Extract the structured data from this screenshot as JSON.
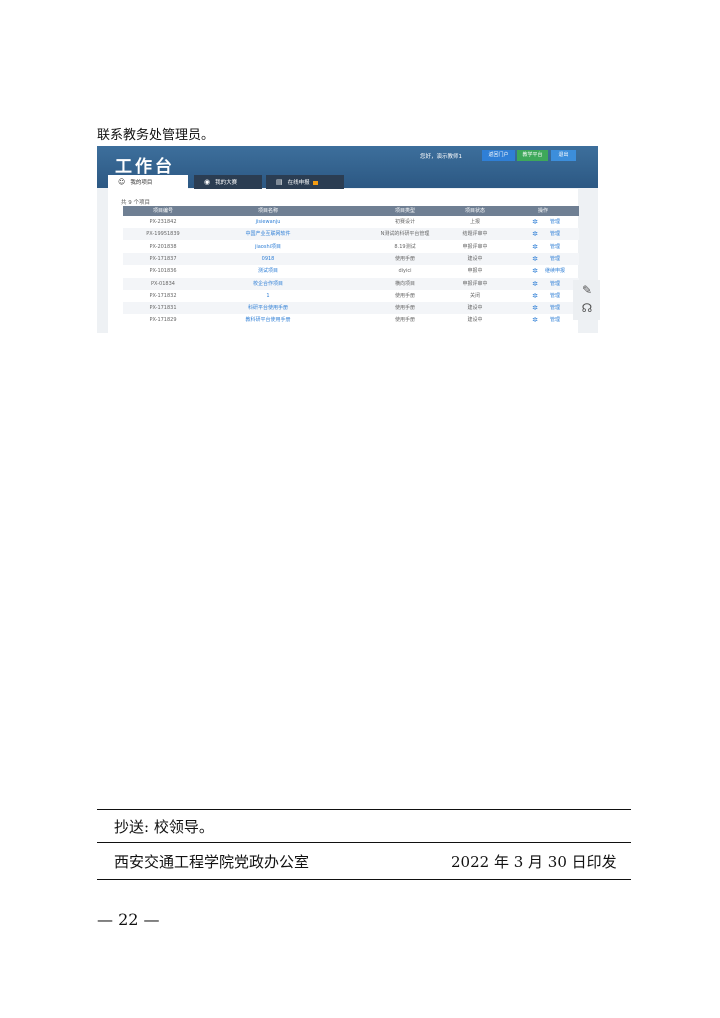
{
  "intro": "联系教务处管理员。",
  "screenshot": {
    "title": "工作台",
    "greeting": "您好，演示教师1",
    "buttons": {
      "portal": "返回门户",
      "teach": "教学平台",
      "exit": "退出"
    },
    "tabs": [
      "我的项目",
      "我的大赛",
      "在线申报"
    ],
    "count": "共 9 个项目",
    "columns": [
      "项目编号",
      "项目名称",
      "项目类型",
      "项目状态",
      "操作"
    ],
    "rows": [
      {
        "id": "PX-231842",
        "name": "jisiewanju",
        "type": "初赛设计",
        "status": "上报",
        "op": "管理"
      },
      {
        "id": "PX-19951839",
        "name": "中国产业互联网软件",
        "type": "N测试的科研平台管理",
        "status": "结题评审中",
        "op": "管理"
      },
      {
        "id": "PX-201838",
        "name": "jiaoshi项目",
        "type": "8.19测试",
        "status": "申报评审中",
        "op": "管理"
      },
      {
        "id": "PX-171837",
        "name": "0918",
        "type": "使用手册",
        "status": "建设中",
        "op": "管理"
      },
      {
        "id": "PX-101836",
        "name": "测试项目",
        "type": "diyici",
        "status": "申报中",
        "op": "继续申报"
      },
      {
        "id": "PX-01834",
        "name": "校企合作项目",
        "type": "横向项目",
        "status": "申报评审中",
        "op": "管理"
      },
      {
        "id": "PX-171832",
        "name": "1",
        "type": "使用手册",
        "status": "关闭",
        "op": "管理"
      },
      {
        "id": "PX-171831",
        "name": "科研平台使用手册",
        "type": "使用手册",
        "status": "建设中",
        "op": "管理"
      },
      {
        "id": "PX-171829",
        "name": "教科研平台使用手册",
        "type": "使用手册",
        "status": "建设中",
        "op": "管理"
      }
    ]
  },
  "footer": {
    "cc": "抄送: 校领导。",
    "issuer": "西安交通工程学院党政办公室",
    "date": "2022 年 3 月 30 日印发"
  },
  "page_number": "— 22 —"
}
